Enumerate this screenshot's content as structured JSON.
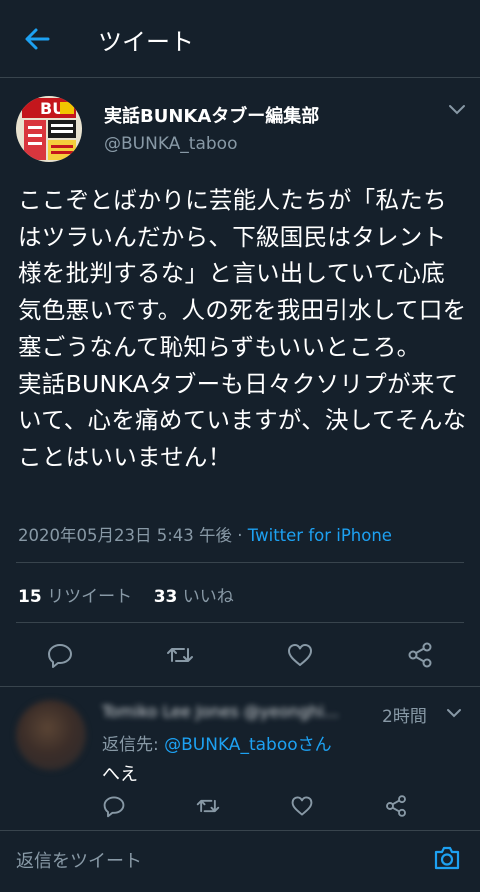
{
  "header": {
    "title": "ツイート",
    "back_icon": "arrow-left-icon"
  },
  "tweet": {
    "display_name": "実話BUNKAタブー編集部",
    "handle": "@BUNKA_taboo",
    "text": "ここぞとばかりに芸能人たちが「私たちはツラいんだから、下級国民はタレント様を批判するな」と言い出していて心底気色悪いです。人の死を我田引水して口を塞ごうなんて恥知らずもいいところ。\n実話BUNKAタブーも日々クソリプが来ていて、心を痛めていますが、決してそんなことはいいません！",
    "timestamp": "2020年05月23日 5:43 午後",
    "separator": " · ",
    "source": "Twitter for iPhone",
    "retweet_count": "15",
    "retweet_label": " リツイート",
    "like_count": "33",
    "like_label": " いいね"
  },
  "actions": [
    "reply-icon",
    "retweet-icon",
    "like-icon",
    "share-icon"
  ],
  "reply": {
    "author": "Tomiko Lee Jones @yeonghi...",
    "time": "2時間",
    "reply_to_label": "返信先: ",
    "reply_to_handle": "@BUNKA_taboo",
    "reply_to_suffix": "さん",
    "text": "へえ"
  },
  "composer": {
    "placeholder": "返信をツイート",
    "camera_icon": "camera-icon"
  },
  "colors": {
    "background": "#15202b",
    "accent": "#1da1f2",
    "muted": "#8899a6",
    "divider": "#38444d"
  }
}
